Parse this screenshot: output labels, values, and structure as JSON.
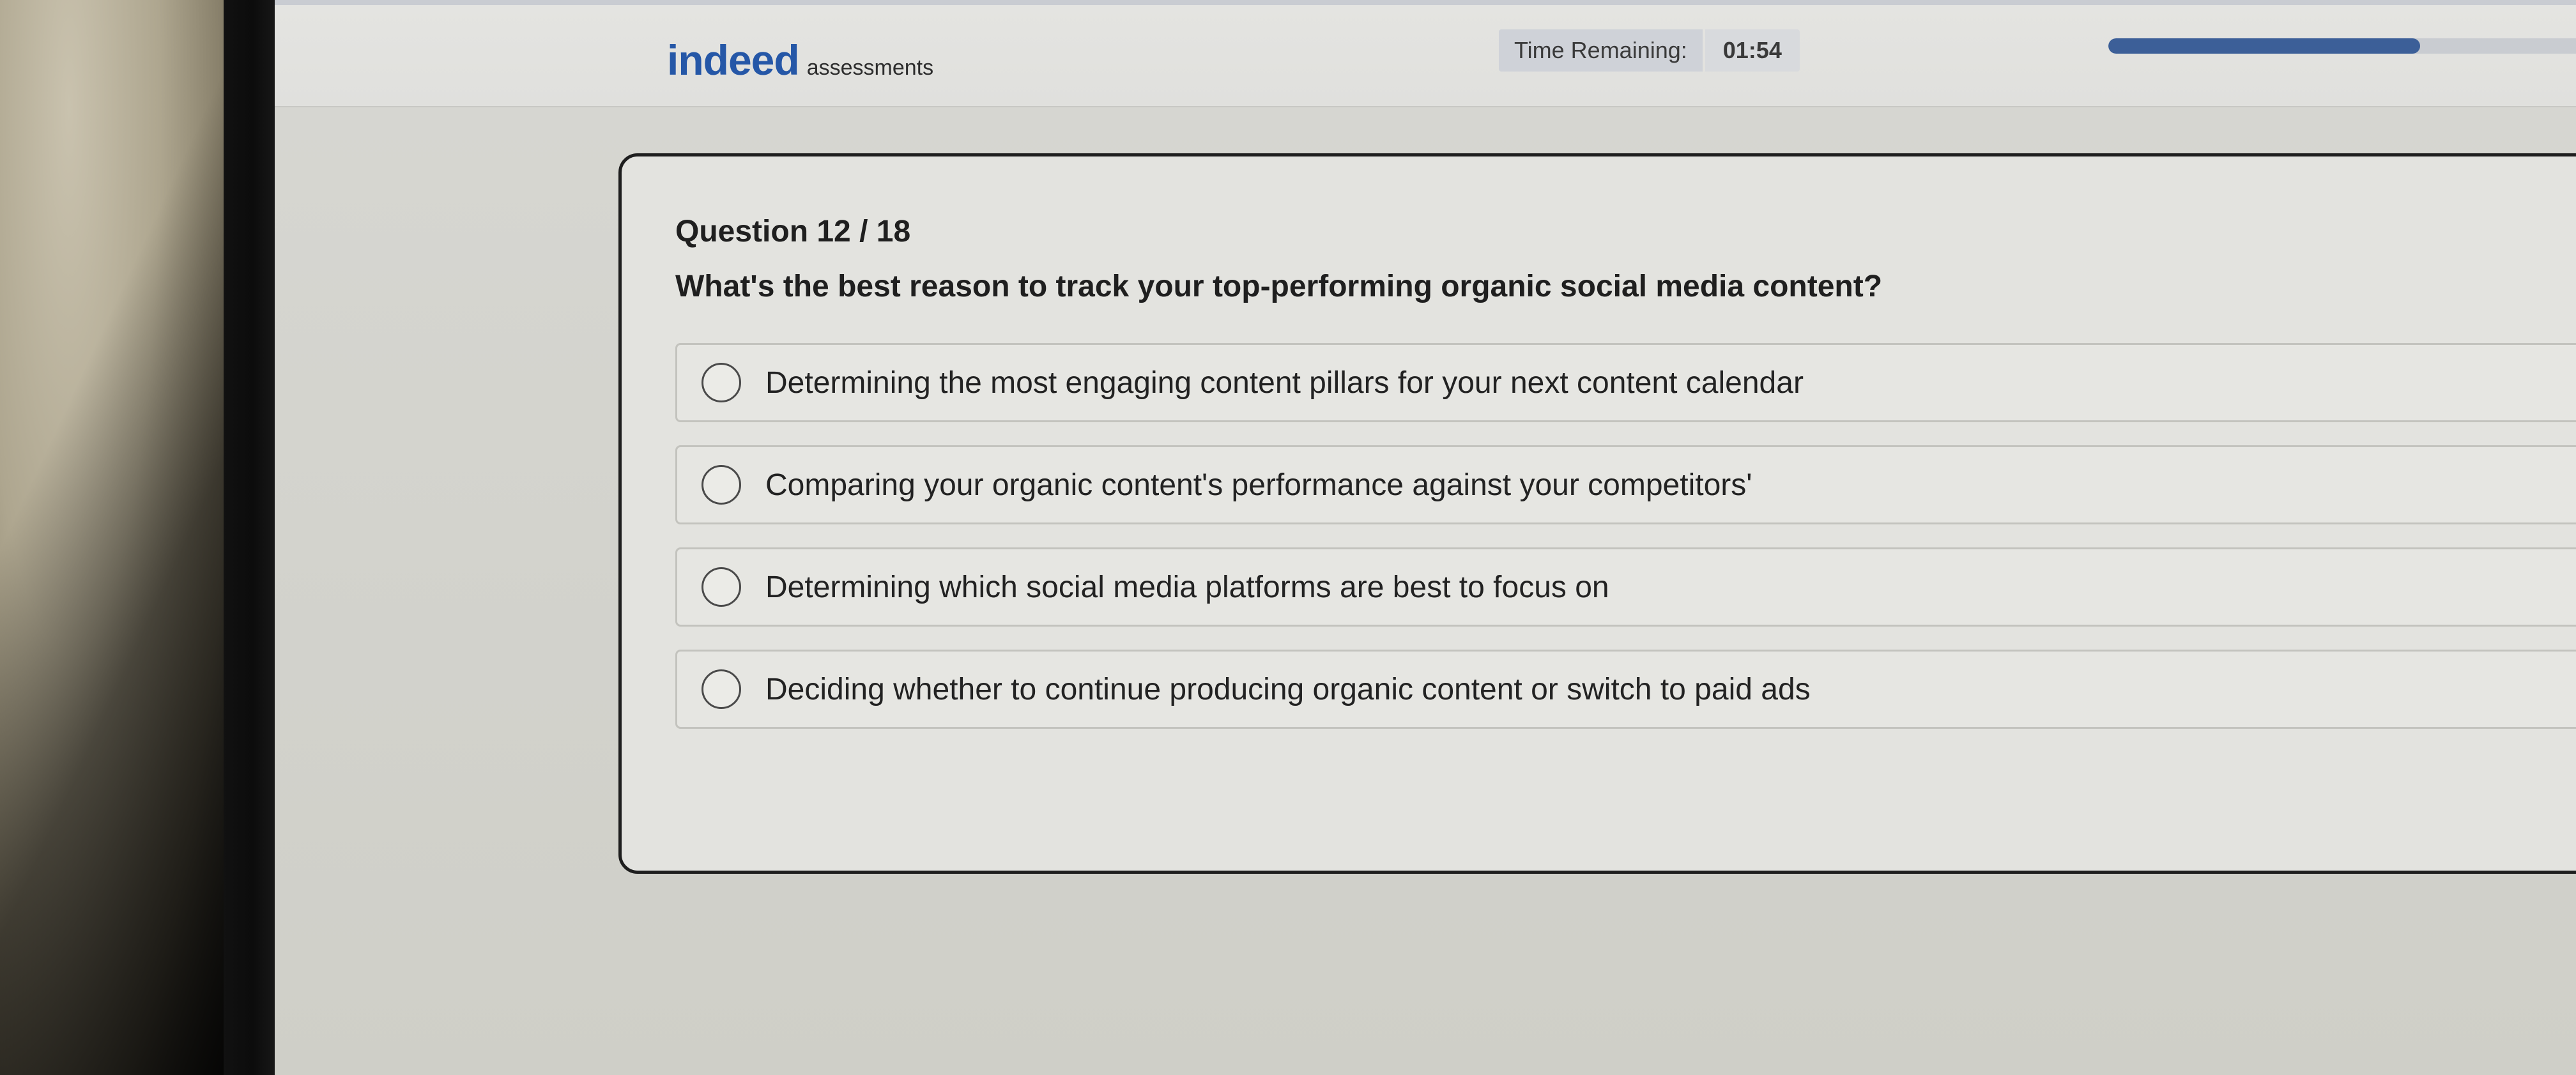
{
  "header": {
    "logo_word": "indeed",
    "logo_sub": "assessments",
    "timer_label": "Time Remaining:",
    "timer_value": "01:54",
    "progress_fraction": 0.667
  },
  "question": {
    "number_label": "Question 12 / 18",
    "text": "What's the best reason to track your top-performing organic social media content?",
    "options": [
      {
        "label": "Determining the most engaging content pillars for your next content calendar"
      },
      {
        "label": "Comparing your organic content's performance against your competitors'"
      },
      {
        "label": "Determining which social media platforms are best to focus on"
      },
      {
        "label": "Deciding whether to continue producing organic content or switch to paid ads"
      }
    ]
  },
  "colors": {
    "brand_blue": "#2557a7",
    "progress_fill": "#3c5f98",
    "card_border": "#1e1e1e"
  }
}
